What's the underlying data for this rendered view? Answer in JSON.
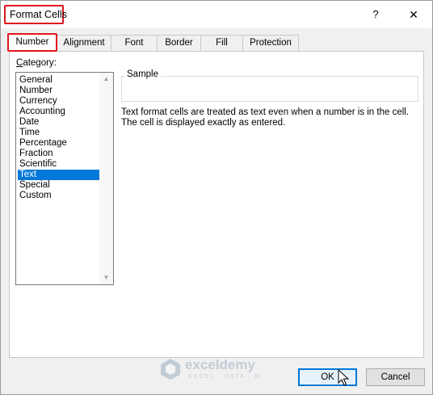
{
  "window": {
    "title": "Format Cells",
    "help_label": "?",
    "close_label": "✕"
  },
  "tabs": [
    {
      "label": "Number",
      "active": true
    },
    {
      "label": "Alignment",
      "active": false
    },
    {
      "label": "Font",
      "active": false
    },
    {
      "label": "Border",
      "active": false
    },
    {
      "label": "Fill",
      "active": false
    },
    {
      "label": "Protection",
      "active": false
    }
  ],
  "category": {
    "label_first": "C",
    "label_rest": "ategory:",
    "items": [
      "General",
      "Number",
      "Currency",
      "Accounting",
      "Date",
      "Time",
      "Percentage",
      "Fraction",
      "Scientific",
      "Text",
      "Special",
      "Custom"
    ],
    "selected": "Text"
  },
  "sample": {
    "label": "Sample"
  },
  "description": {
    "line1": "Text format cells are treated as text even when a number is in the cell.",
    "line2": "The cell is displayed exactly as entered."
  },
  "watermark": {
    "name": "exceldemy",
    "tagline": "EXCEL · DATA · BI"
  },
  "buttons": {
    "ok": "OK",
    "cancel": "Cancel"
  },
  "colors": {
    "highlight_border": "#e0161d",
    "selection": "#0078d7"
  }
}
